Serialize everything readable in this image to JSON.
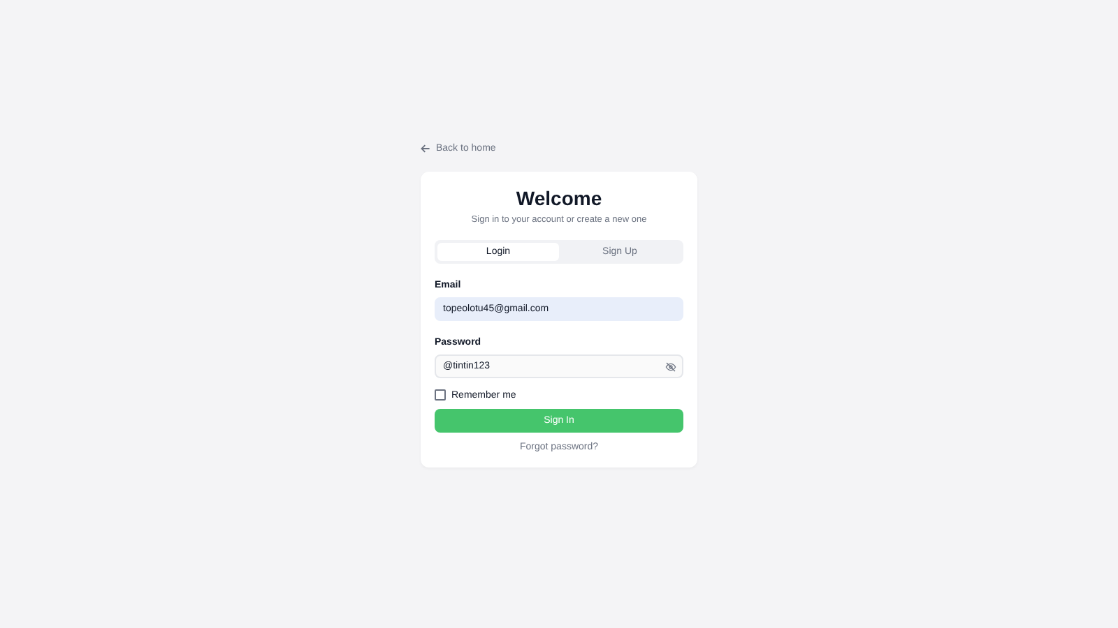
{
  "back_link": {
    "label": "Back to home"
  },
  "title": "Welcome",
  "subtitle": "Sign in to your account or create a new one",
  "tabs": [
    {
      "label": "Login",
      "selected": true
    },
    {
      "label": "Sign Up",
      "selected": false
    }
  ],
  "email": {
    "label": "Email",
    "value": "topeolotu45@gmail.com"
  },
  "password": {
    "label": "Password",
    "value": "@tintin123",
    "visible": true
  },
  "remember": {
    "label": "Remember me",
    "checked": false
  },
  "sign_in_button": "Sign In",
  "forgot_link": "Forgot password?"
}
